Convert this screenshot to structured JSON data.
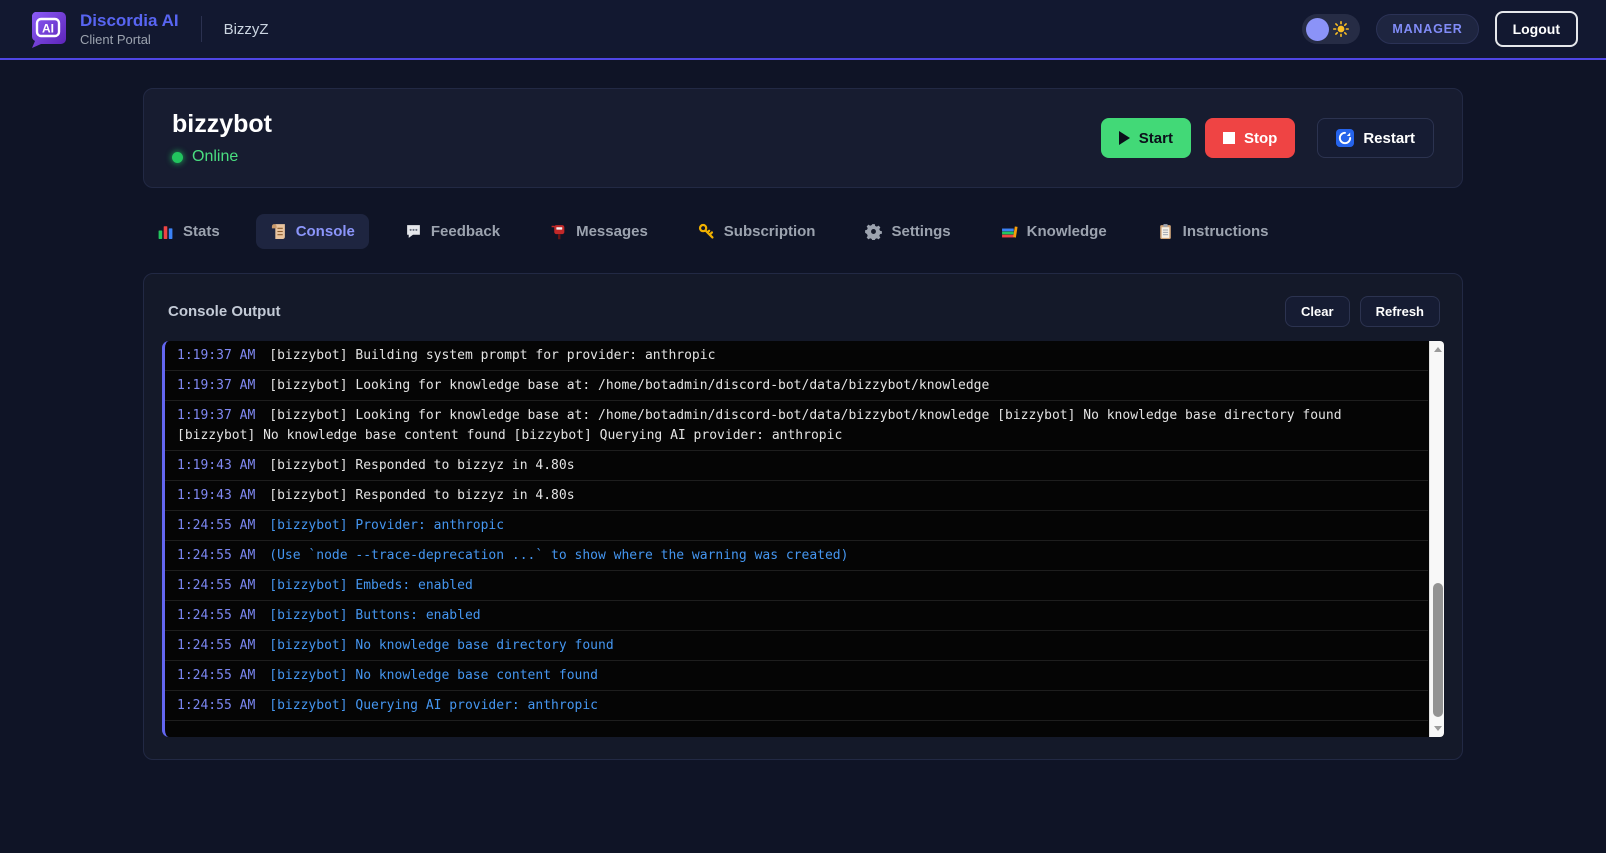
{
  "brand": {
    "logo_text": "AI",
    "title": "Discordia AI",
    "subtitle": "Client Portal"
  },
  "nav": {
    "bot_name": "BizzyZ",
    "role_badge": "MANAGER",
    "logout_label": "Logout"
  },
  "bot_card": {
    "name": "bizzybot",
    "status": "Online",
    "start_label": "Start",
    "stop_label": "Stop",
    "restart_label": "Restart"
  },
  "tabs": [
    {
      "label": "Stats",
      "icon": "bar-chart-icon",
      "active": false
    },
    {
      "label": "Console",
      "icon": "scroll-icon",
      "active": true
    },
    {
      "label": "Feedback",
      "icon": "speech-balloon-icon",
      "active": false
    },
    {
      "label": "Messages",
      "icon": "postbox-icon",
      "active": false
    },
    {
      "label": "Subscription",
      "icon": "key-icon",
      "active": false
    },
    {
      "label": "Settings",
      "icon": "gear-icon",
      "active": false
    },
    {
      "label": "Knowledge",
      "icon": "books-icon",
      "active": false
    },
    {
      "label": "Instructions",
      "icon": "clipboard-icon",
      "active": false
    }
  ],
  "console": {
    "title": "Console Output",
    "clear_label": "Clear",
    "refresh_label": "Refresh",
    "logs": [
      {
        "time": "1:19:37 AM",
        "text": "[bizzybot] Building system prompt for provider: anthropic",
        "level": "default"
      },
      {
        "time": "1:19:37 AM",
        "text": "[bizzybot] Looking for knowledge base at: /home/botadmin/discord-bot/data/bizzybot/knowledge",
        "level": "default"
      },
      {
        "time": "1:19:37 AM",
        "text": "[bizzybot] Looking for knowledge base at: /home/botadmin/discord-bot/data/bizzybot/knowledge [bizzybot] No knowledge base directory found [bizzybot] No knowledge base content found [bizzybot] Querying AI provider: anthropic",
        "level": "default"
      },
      {
        "time": "1:19:43 AM",
        "text": "[bizzybot] Responded to bizzyz in 4.80s",
        "level": "default"
      },
      {
        "time": "1:19:43 AM",
        "text": "[bizzybot] Responded to bizzyz in 4.80s",
        "level": "default"
      },
      {
        "time": "1:24:55 AM",
        "text": "[bizzybot] Provider: anthropic",
        "level": "info"
      },
      {
        "time": "1:24:55 AM",
        "text": "(Use `node --trace-deprecation ...` to show where the warning was created)",
        "level": "info"
      },
      {
        "time": "1:24:55 AM",
        "text": "[bizzybot] Embeds: enabled",
        "level": "info"
      },
      {
        "time": "1:24:55 AM",
        "text": "[bizzybot] Buttons: enabled",
        "level": "info"
      },
      {
        "time": "1:24:55 AM",
        "text": "[bizzybot] No knowledge base directory found",
        "level": "info"
      },
      {
        "time": "1:24:55 AM",
        "text": "[bizzybot] No knowledge base content found",
        "level": "info"
      },
      {
        "time": "1:24:55 AM",
        "text": "[bizzybot] Querying AI provider: anthropic",
        "level": "info"
      }
    ]
  },
  "colors": {
    "accent": "#6366f1",
    "brand_blue": "#5865f2",
    "success_green": "#42d977",
    "danger_red": "#ef4444",
    "timestamp_indigo": "#8089f2",
    "info_blue": "#4596f0",
    "badge_text": "#818cf8"
  }
}
